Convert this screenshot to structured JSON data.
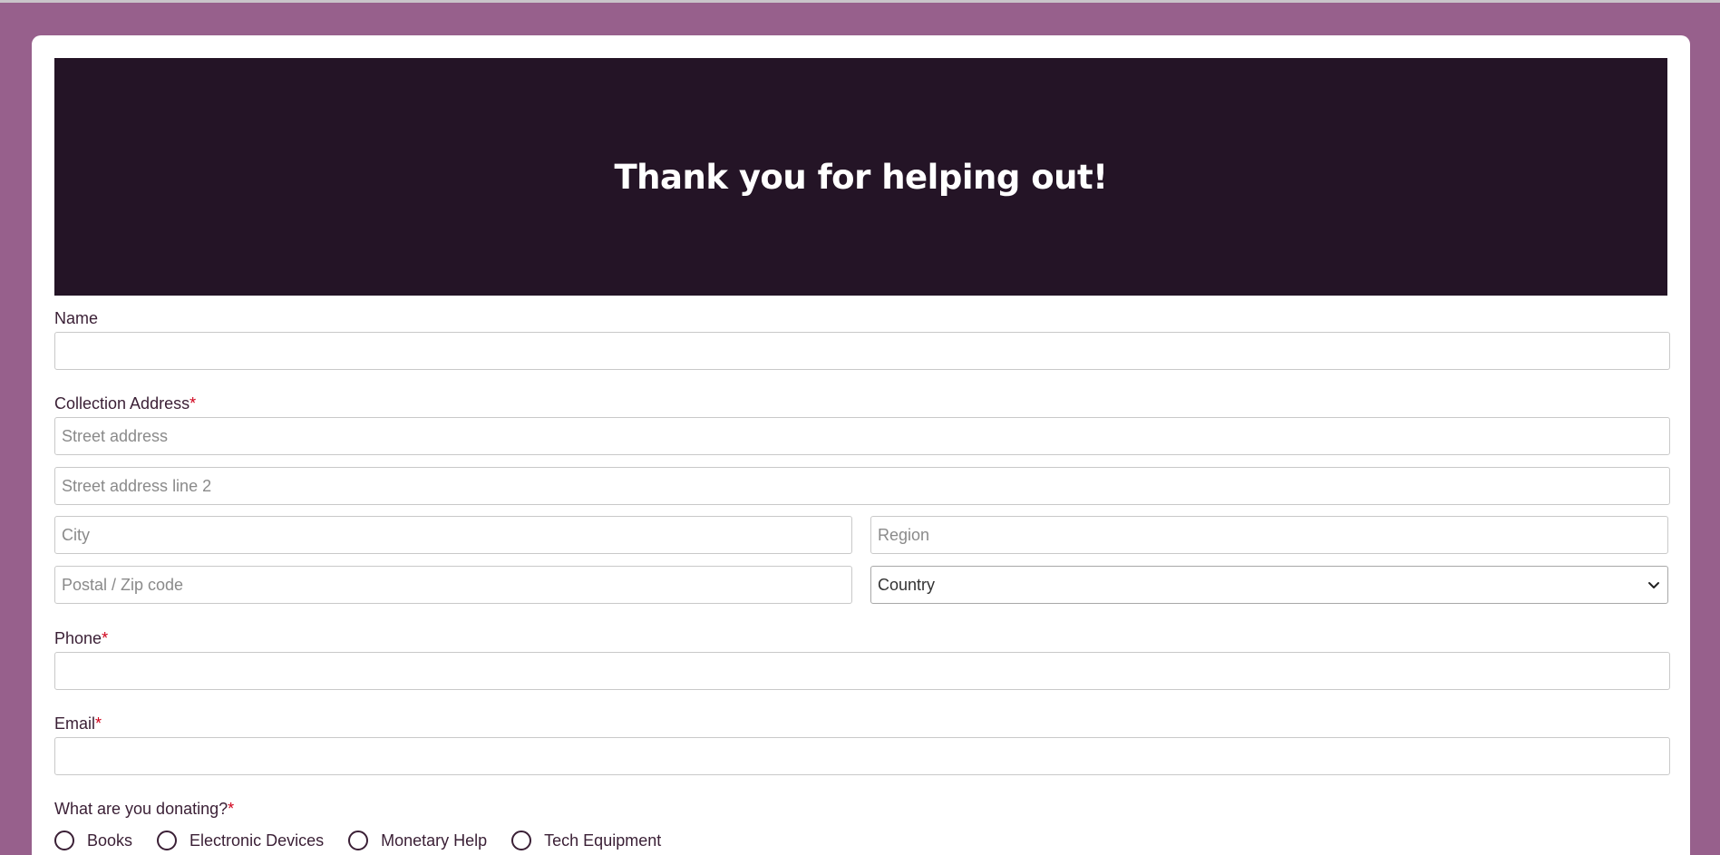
{
  "page": {
    "banner_title": "Thank you for helping out!"
  },
  "form": {
    "name": {
      "label": "Name",
      "value": ""
    },
    "address": {
      "label": "Collection Address",
      "required_mark": "*",
      "street_placeholder": "Street address",
      "street2_placeholder": "Street address line 2",
      "city_placeholder": "City",
      "region_placeholder": "Region",
      "postal_placeholder": "Postal / Zip code",
      "country_selected": "Country"
    },
    "phone": {
      "label": "Phone",
      "required_mark": "*",
      "value": ""
    },
    "email": {
      "label": "Email",
      "required_mark": "*",
      "value": ""
    },
    "donation": {
      "label": "What are you donating?",
      "required_mark": "*",
      "options": [
        "Books",
        "Electronic Devices",
        "Monetary Help",
        "Tech Equipment"
      ]
    }
  },
  "colors": {
    "page_background": "#97608c",
    "banner_background": "#241426",
    "required_mark": "#d0021b",
    "text": "#3a1f35"
  },
  "icons": {
    "select_arrow": "chevron-down-icon"
  }
}
